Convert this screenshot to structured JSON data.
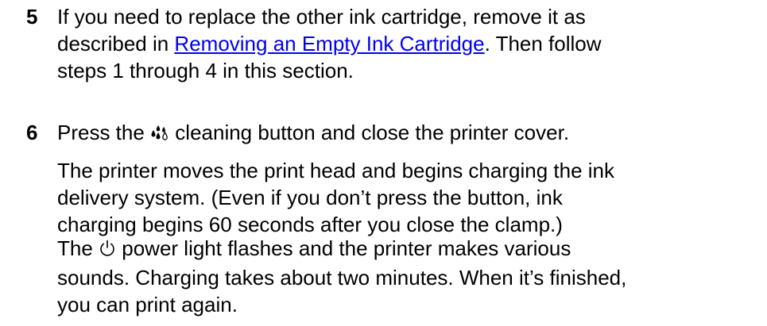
{
  "steps": [
    {
      "number": "5",
      "lines": [
        {
          "text": "If you need to replace the other ink cartridge, remove it as"
        },
        {
          "before": "described in ",
          "link": "Removing an Empty Ink Cartridge",
          "after": ". Then follow"
        },
        {
          "text": "steps 1 through 4 in this section."
        }
      ]
    },
    {
      "number": "6",
      "intro": {
        "before": "Press the ",
        "icon": "cleaning-button-icon",
        "after": " cleaning button and close the printer cover."
      },
      "para2": [
        "The printer moves the print head and begins charging the ink",
        "delivery system. (Even if you don’t press the button, ink",
        "charging begins 60 seconds after you close the clamp.)"
      ],
      "para3": {
        "first_before": "The ",
        "icon": "power-icon",
        "first_after": " power light flashes and the printer makes various",
        "lines": [
          "sounds. Charging takes about two minutes. When it’s finished,",
          "you can print again."
        ]
      }
    }
  ],
  "colors": {
    "text": "#000000",
    "link": "#0000ee"
  }
}
